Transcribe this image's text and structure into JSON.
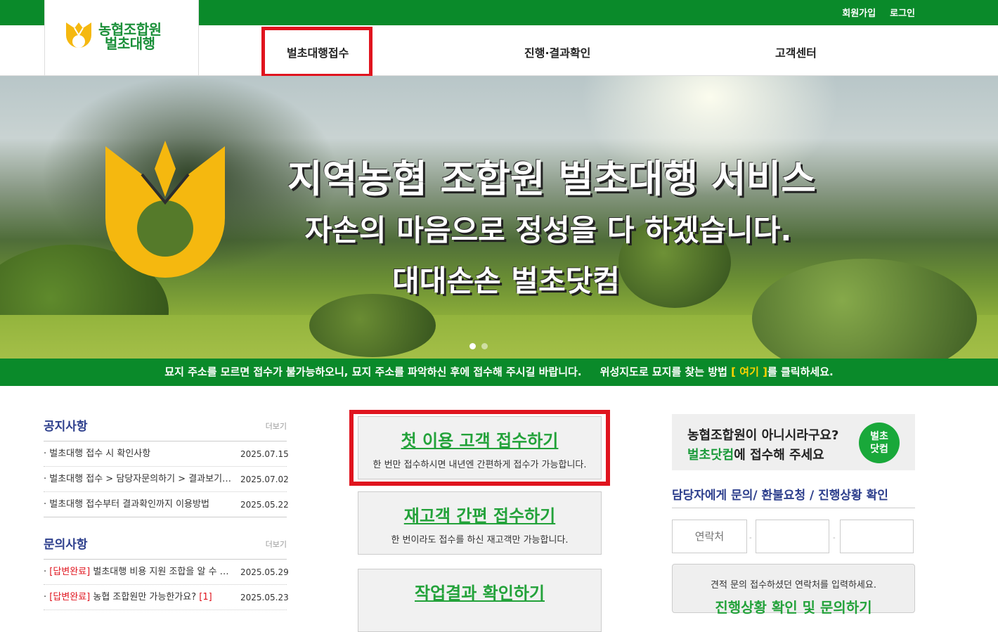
{
  "topbar": {
    "signup": "회원가입",
    "login": "로그인"
  },
  "logo": {
    "line1": "농협조합원",
    "line2": "벌초대행"
  },
  "nav": {
    "item1": "벌초대행접수",
    "item2": "진행·결과확인",
    "item3": "고객센터"
  },
  "hero": {
    "headline1": "지역농협 조합원 벌초대행 서비스",
    "headline2": "자손의 마음으로 정성을 다 하겠습니다.",
    "headline3": "대대손손 벌초닷컴"
  },
  "notice_bar": {
    "text1": "묘지 주소를 모르면 접수가 불가능하오니, 묘지 주소를 파악하신 후에 접수해 주시길 바랍니다.",
    "text2": "위성지도로 묘지를 찾는 방법",
    "link_open": "[",
    "link": "여기",
    "link_close": "]",
    "text3": "를 클릭하세요."
  },
  "notices": {
    "title": "공지사항",
    "more": "더보기",
    "items": [
      {
        "text": "· 벌초대행 접수 시 확인사항",
        "date": "2025.07.15"
      },
      {
        "text": "· 벌초대행 접수 > 담당자문의하기 > 결과보기까지",
        "date": "2025.07.02"
      },
      {
        "text": "· 벌초대행 접수부터 결과확인까지 이용방법",
        "date": "2025.05.22"
      }
    ]
  },
  "inquiries": {
    "title": "문의사항",
    "more": "더보기",
    "items": [
      {
        "prefix": "· ",
        "badge": "[답변완료]",
        "text": " 벌초대행 비용 지원 조합을 알 수 있나요?",
        "count": "",
        "date": "2025.05.29"
      },
      {
        "prefix": "· ",
        "badge": "[답변완료]",
        "text": " 농협 조합원만 가능한가요?",
        "count": " [1]",
        "date": "2025.05.23"
      }
    ]
  },
  "buttons": {
    "first": {
      "main": "첫 이용 고객 접수하기",
      "sub": "한 번만 접수하시면 내년엔 간편하게 접수가 가능합니다."
    },
    "repeat": {
      "main": "재고객 간편 접수하기",
      "sub": "한 번이라도 접수를 하신 재고객만 가능합니다."
    },
    "result": {
      "main": "작업결과 확인하기",
      "sub": ""
    }
  },
  "promo": {
    "line1": "농협조합원이 아니시라구요?",
    "line2_green": "벌초닷컴",
    "line2_rest": "에 접수해 주세요",
    "circle_l1": "벌초",
    "circle_l2": "닷컴"
  },
  "inquiry_panel": {
    "title": "담당자에게 문의/ 환불요청 / 진행상황 확인",
    "phone_placeholder": "연락처",
    "dash": "-",
    "box_text": "견적 문의 접수하셨던 연락처를 입력하세요.",
    "box_button": "진행상황 확인 및 문의하기"
  },
  "colors": {
    "brand_green": "#0a8a2a",
    "accent_red": "#e0141e",
    "title_blue": "#2c3e8c",
    "emblem_yellow": "#f5b80f"
  },
  "hero_slides": {
    "total": 2,
    "active": 1
  }
}
